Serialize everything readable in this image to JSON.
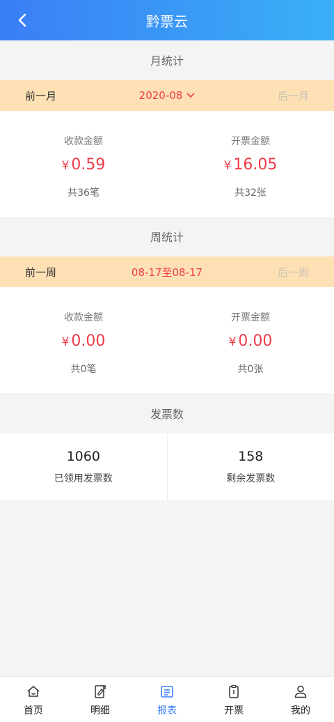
{
  "header": {
    "title": "黔票云"
  },
  "monthly": {
    "section_title": "月统计",
    "prev_label": "前一月",
    "current": "2020-08",
    "next_label": "后一月",
    "receipt": {
      "label": "收款金额",
      "currency": "¥",
      "amount": "0.59",
      "count": "共36笔"
    },
    "invoice": {
      "label": "开票金额",
      "currency": "¥",
      "amount": "16.05",
      "count": "共32张"
    }
  },
  "weekly": {
    "section_title": "周统计",
    "prev_label": "前一周",
    "current": "08-17至08-17",
    "next_label": "后一周",
    "receipt": {
      "label": "收款金额",
      "currency": "¥",
      "amount": "0.00",
      "count": "共0笔"
    },
    "invoice": {
      "label": "开票金额",
      "currency": "¥",
      "amount": "0.00",
      "count": "共0张"
    }
  },
  "invoices": {
    "section_title": "发票数",
    "received": {
      "value": "1060",
      "label": "已领用发票数"
    },
    "remaining": {
      "value": "158",
      "label": "剩余发票数"
    }
  },
  "tabbar": {
    "items": [
      {
        "label": "首页",
        "icon": "home-icon"
      },
      {
        "label": "明细",
        "icon": "detail-icon"
      },
      {
        "label": "报表",
        "icon": "report-icon",
        "active": true
      },
      {
        "label": "开票",
        "icon": "invoice-icon"
      },
      {
        "label": "我的",
        "icon": "user-icon"
      }
    ]
  },
  "colors": {
    "accent": "#3a7ef5",
    "amount": "#f03b48",
    "period_bar": "#fde1b4"
  }
}
